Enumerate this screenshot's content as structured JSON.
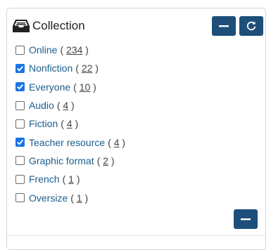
{
  "panel": {
    "title": "Collection",
    "header_icon": "inbox-tray-icon",
    "collapse_icon": "minus-icon",
    "refresh_icon": "refresh-icon"
  },
  "facets": [
    {
      "label": "Online",
      "count": "234",
      "checked": false
    },
    {
      "label": "Nonfiction",
      "count": "22",
      "checked": true
    },
    {
      "label": "Everyone",
      "count": "10",
      "checked": true
    },
    {
      "label": "Audio",
      "count": "4",
      "checked": false
    },
    {
      "label": "Fiction",
      "count": "4",
      "checked": false
    },
    {
      "label": "Teacher resource",
      "count": "4",
      "checked": true
    },
    {
      "label": "Graphic format",
      "count": "2",
      "checked": false
    },
    {
      "label": "French",
      "count": "1",
      "checked": false
    },
    {
      "label": "Oversize",
      "count": "1",
      "checked": false
    }
  ],
  "colors": {
    "button_bg": "#1e4f7a",
    "label_link": "#1b5e8c",
    "checkbox_checked": "#1a73e8"
  }
}
